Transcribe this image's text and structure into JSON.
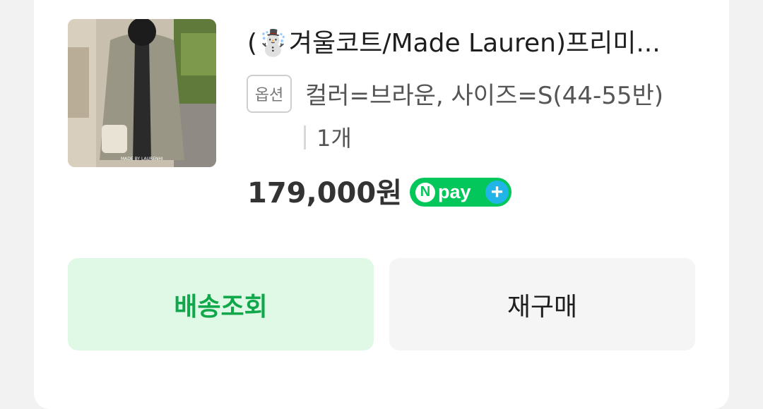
{
  "product": {
    "title": "(☃️겨울코트/Made Lauren)프리미...",
    "option_badge": "옵션",
    "option_text": "컬러=브라운, 사이즈=S(44-55반)",
    "quantity": "1개",
    "price": "179,000원",
    "image_watermark": "MADE BY LAURENHI"
  },
  "npay": {
    "n_letter": "N",
    "word": "pay",
    "plus": "+",
    "colors": {
      "green": "#03c75a",
      "blue": "#20b5e6"
    }
  },
  "actions": {
    "track_label": "배송조회",
    "reorder_label": "재구매"
  },
  "colors": {
    "track_bg": "#dff9e6",
    "track_text": "#10a84a",
    "reorder_bg": "#f5f5f5"
  }
}
